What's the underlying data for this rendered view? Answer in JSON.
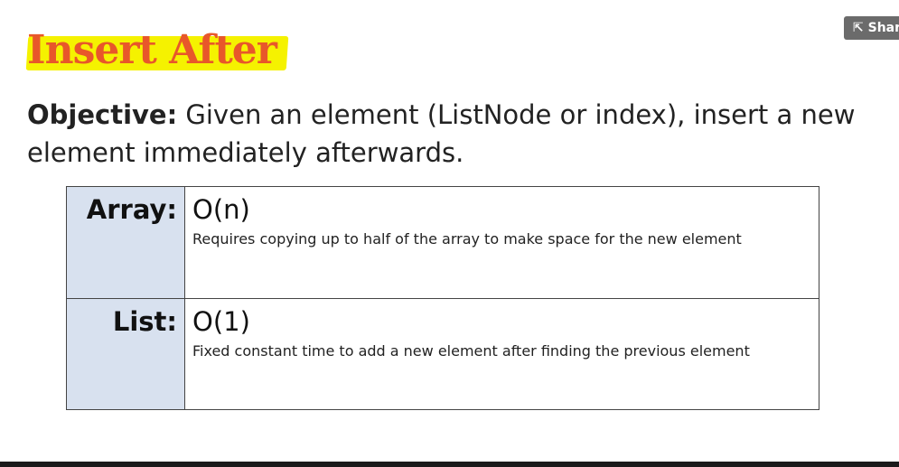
{
  "title": "Insert After",
  "share_label": "Share",
  "objective": {
    "label": "Objective:",
    "text": "Given an element (ListNode or index), insert a new element immediately afterwards."
  },
  "rows": [
    {
      "label": "Array:",
      "complexity": "O(n)",
      "description": "Requires copying up to half of the array to make space for the new element"
    },
    {
      "label": "List:",
      "complexity": "O(1)",
      "description": "Fixed constant time to add a new element",
      "description_highlight": "after finding the previous element"
    }
  ],
  "colors": {
    "title": "#e8572a",
    "highlight": "#f5f200",
    "label_cell_bg": "#d8e1ef"
  }
}
